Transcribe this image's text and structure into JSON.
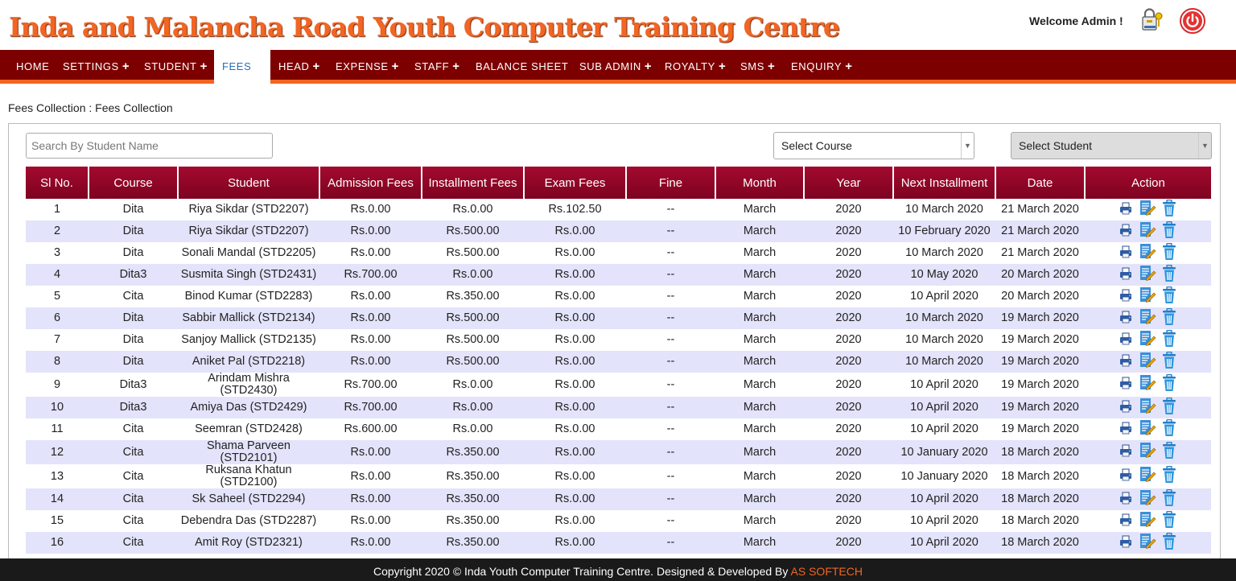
{
  "site": {
    "title": "Inda and Malancha Road Youth Computer Training Centre"
  },
  "user": {
    "welcome": "Welcome Admin !"
  },
  "nav": [
    {
      "label": "HOME",
      "plus": ""
    },
    {
      "label": "SETTINGS",
      "plus": "+"
    },
    {
      "label": "STUDENT",
      "plus": "+"
    },
    {
      "label": "FEES",
      "plus": "",
      "active": true
    },
    {
      "label": "HEAD",
      "plus": "+"
    },
    {
      "label": "EXPENSE",
      "plus": "+"
    },
    {
      "label": "STAFF",
      "plus": "+"
    },
    {
      "label": "BALANCE SHEET",
      "plus": ""
    },
    {
      "label": "SUB ADMIN",
      "plus": "+"
    },
    {
      "label": "ROYALTY",
      "plus": "+"
    },
    {
      "label": "SMS",
      "plus": "+"
    },
    {
      "label": "ENQUIRY",
      "plus": "+"
    }
  ],
  "breadcrumb": "Fees Collection : Fees Collection",
  "filters": {
    "search_placeholder": "Search By Student Name",
    "course_select": "Select Course",
    "student_select": "Select Student"
  },
  "table": {
    "headers": [
      "Sl No.",
      "Course",
      "Student",
      "Admission Fees",
      "Installment Fees",
      "Exam Fees",
      "Fine",
      "Month",
      "Year",
      "Next Installment",
      "Date",
      "Action"
    ],
    "rows": [
      {
        "sl": "1",
        "course": "Dita",
        "student": "Riya Sikdar (STD2207)",
        "admission": "Rs.0.00",
        "installment": "Rs.0.00",
        "exam": "Rs.102.50",
        "fine": "--",
        "month": "March",
        "year": "2020",
        "next": "10 March 2020",
        "date": "21 March 2020"
      },
      {
        "sl": "2",
        "course": "Dita",
        "student": "Riya Sikdar (STD2207)",
        "admission": "Rs.0.00",
        "installment": "Rs.500.00",
        "exam": "Rs.0.00",
        "fine": "--",
        "month": "March",
        "year": "2020",
        "next": "10 February 2020",
        "date": "21 March 2020"
      },
      {
        "sl": "3",
        "course": "Dita",
        "student": "Sonali Mandal (STD2205)",
        "admission": "Rs.0.00",
        "installment": "Rs.500.00",
        "exam": "Rs.0.00",
        "fine": "--",
        "month": "March",
        "year": "2020",
        "next": "10 March 2020",
        "date": "21 March 2020"
      },
      {
        "sl": "4",
        "course": "Dita3",
        "student": "Susmita Singh (STD2431)",
        "admission": "Rs.700.00",
        "installment": "Rs.0.00",
        "exam": "Rs.0.00",
        "fine": "--",
        "month": "March",
        "year": "2020",
        "next": "10 May 2020",
        "date": "20 March 2020"
      },
      {
        "sl": "5",
        "course": "Cita",
        "student": "Binod Kumar (STD2283)",
        "admission": "Rs.0.00",
        "installment": "Rs.350.00",
        "exam": "Rs.0.00",
        "fine": "--",
        "month": "March",
        "year": "2020",
        "next": "10 April 2020",
        "date": "20 March 2020"
      },
      {
        "sl": "6",
        "course": "Dita",
        "student": "Sabbir Mallick (STD2134)",
        "admission": "Rs.0.00",
        "installment": "Rs.500.00",
        "exam": "Rs.0.00",
        "fine": "--",
        "month": "March",
        "year": "2020",
        "next": "10 March 2020",
        "date": "19 March 2020"
      },
      {
        "sl": "7",
        "course": "Dita",
        "student": "Sanjoy Mallick (STD2135)",
        "admission": "Rs.0.00",
        "installment": "Rs.500.00",
        "exam": "Rs.0.00",
        "fine": "--",
        "month": "March",
        "year": "2020",
        "next": "10 March 2020",
        "date": "19 March 2020"
      },
      {
        "sl": "8",
        "course": "Dita",
        "student": "Aniket Pal (STD2218)",
        "admission": "Rs.0.00",
        "installment": "Rs.500.00",
        "exam": "Rs.0.00",
        "fine": "--",
        "month": "March",
        "year": "2020",
        "next": "10 March 2020",
        "date": "19 March 2020"
      },
      {
        "sl": "9",
        "course": "Dita3",
        "student": "Arindam Mishra (STD2430)",
        "admission": "Rs.700.00",
        "installment": "Rs.0.00",
        "exam": "Rs.0.00",
        "fine": "--",
        "month": "March",
        "year": "2020",
        "next": "10 April 2020",
        "date": "19 March 2020",
        "wrap": true
      },
      {
        "sl": "10",
        "course": "Dita3",
        "student": "Amiya Das (STD2429)",
        "admission": "Rs.700.00",
        "installment": "Rs.0.00",
        "exam": "Rs.0.00",
        "fine": "--",
        "month": "March",
        "year": "2020",
        "next": "10 April 2020",
        "date": "19 March 2020"
      },
      {
        "sl": "11",
        "course": "Cita",
        "student": "Seemran (STD2428)",
        "admission": "Rs.600.00",
        "installment": "Rs.0.00",
        "exam": "Rs.0.00",
        "fine": "--",
        "month": "March",
        "year": "2020",
        "next": "10 April 2020",
        "date": "19 March 2020"
      },
      {
        "sl": "12",
        "course": "Cita",
        "student": "Shama Parveen (STD2101)",
        "admission": "Rs.0.00",
        "installment": "Rs.350.00",
        "exam": "Rs.0.00",
        "fine": "--",
        "month": "March",
        "year": "2020",
        "next": "10 January 2020",
        "date": "18 March 2020",
        "wrap": true
      },
      {
        "sl": "13",
        "course": "Cita",
        "student": "Ruksana Khatun (STD2100)",
        "admission": "Rs.0.00",
        "installment": "Rs.350.00",
        "exam": "Rs.0.00",
        "fine": "--",
        "month": "March",
        "year": "2020",
        "next": "10 January 2020",
        "date": "18 March 2020",
        "wrap": true
      },
      {
        "sl": "14",
        "course": "Cita",
        "student": "Sk Saheel (STD2294)",
        "admission": "Rs.0.00",
        "installment": "Rs.350.00",
        "exam": "Rs.0.00",
        "fine": "--",
        "month": "March",
        "year": "2020",
        "next": "10 April 2020",
        "date": "18 March 2020"
      },
      {
        "sl": "15",
        "course": "Cita",
        "student": "Debendra Das (STD2287)",
        "admission": "Rs.0.00",
        "installment": "Rs.350.00",
        "exam": "Rs.0.00",
        "fine": "--",
        "month": "March",
        "year": "2020",
        "next": "10 April 2020",
        "date": "18 March 2020"
      },
      {
        "sl": "16",
        "course": "Cita",
        "student": "Amit Roy (STD2321)",
        "admission": "Rs.0.00",
        "installment": "Rs.350.00",
        "exam": "Rs.0.00",
        "fine": "--",
        "month": "March",
        "year": "2020",
        "next": "10 April 2020",
        "date": "18 March 2020"
      }
    ]
  },
  "action_icons": [
    "print-icon",
    "edit-icon",
    "delete-icon"
  ],
  "footer": {
    "text": "Copyright 2020 © Inda Youth Computer Training Centre. Designed & Developed By",
    "brand": "AS SOFTECH"
  },
  "colors": {
    "brand_orange": "#f26522",
    "nav_bg": "#7d0000",
    "table_header": "#8f0526",
    "row_alt": "#e3e3fb",
    "footer_bg": "#1a1a1a"
  }
}
